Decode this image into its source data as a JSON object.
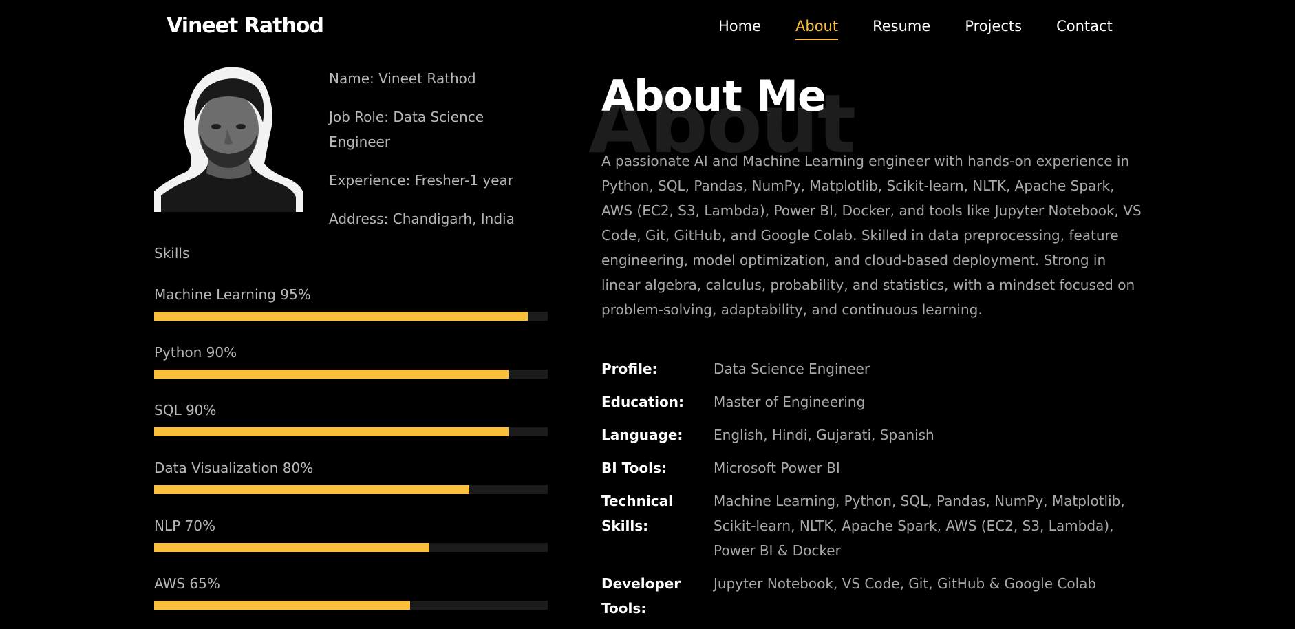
{
  "nav": {
    "brand": "Vineet Rathod",
    "links": [
      "Home",
      "About",
      "Resume",
      "Projects",
      "Contact"
    ],
    "active": "About"
  },
  "profile": {
    "name": "Name: Vineet Rathod",
    "role": "Job Role: Data Science Engineer",
    "experience": "Experience: Fresher-1 year",
    "address": "Address: Chandigarh, India"
  },
  "skills": {
    "title": "Skills",
    "items": [
      {
        "label": "Machine Learning 95%",
        "percent": 95
      },
      {
        "label": "Python 90%",
        "percent": 90
      },
      {
        "label": "SQL 90%",
        "percent": 90
      },
      {
        "label": "Data Visualization 80%",
        "percent": 80
      },
      {
        "label": "NLP 70%",
        "percent": 70
      },
      {
        "label": "AWS 65%",
        "percent": 65
      }
    ]
  },
  "about": {
    "bg_word": "About",
    "heading": "About Me",
    "text": "A passionate AI and Machine Learning engineer with hands-on experience in Python, SQL, Pandas, NumPy, Matplotlib, Scikit-learn, NLTK, Apache Spark, AWS (EC2, S3, Lambda), Power BI, Docker, and tools like Jupyter Notebook, VS Code, Git, GitHub, and Google Colab. Skilled in data preprocessing, feature engineering, model optimization, and cloud-based deployment. Strong in linear algebra, calculus, probability, and statistics, with a mindset focused on problem-solving, adaptability, and continuous learning."
  },
  "details": [
    {
      "key": "Profile:",
      "value": "Data Science Engineer"
    },
    {
      "key": "Education:",
      "value": "Master of Engineering"
    },
    {
      "key": "Language:",
      "value": "English, Hindi, Gujarati, Spanish"
    },
    {
      "key": "BI Tools:",
      "value": "Microsoft Power BI"
    },
    {
      "key": "Technical Skills:",
      "value": "Machine Learning, Python, SQL, Pandas, NumPy, Matplotlib, Scikit-learn, NLTK, Apache Spark, AWS (EC2, S3, Lambda), Power BI & Docker"
    },
    {
      "key": "Developer Tools:",
      "value": "Jupyter Notebook, VS Code, Git, GitHub & Google Colab"
    }
  ],
  "colors": {
    "accent": "#fbbf3c",
    "background": "#000000",
    "muted_text": "#a9a9a9"
  }
}
